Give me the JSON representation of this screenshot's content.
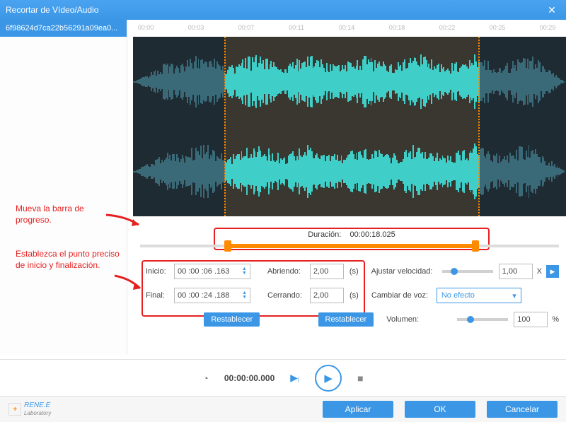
{
  "title": "Recortar de Vídeo/Audio",
  "sidebar": {
    "file_name": "6f98624d7ca22b56291a09ea0..."
  },
  "ruler": [
    "00:00",
    "00:03",
    "00:07",
    "00:11",
    "00:14",
    "00:18",
    "00:22",
    "00:25",
    "00:29"
  ],
  "selection": {
    "start_pct": 21,
    "end_pct": 80
  },
  "duration": {
    "label": "Duración:",
    "value": "00:00:18.025"
  },
  "annotations": {
    "a1": "Mueva la barra de progreso.",
    "a2": "Establezca el punto preciso de inicio y finalización."
  },
  "inputs": {
    "inicio_label": "Inicio:",
    "inicio_value": "00 :00 :06 .163",
    "final_label": "Final:",
    "final_value": "00 :00 :24 .188",
    "abriendo_label": "Abriendo:",
    "abriendo_value": "2,00",
    "cerrando_label": "Cerrando:",
    "cerrando_value": "2,00",
    "secs_unit": "(s)",
    "reset": "Restablecer",
    "speed_label": "Ajustar velocidad:",
    "speed_value": "1,00",
    "speed_unit": "X",
    "voice_label": "Cambiar de voz:",
    "voice_value": "No efecto",
    "volume_label": "Volumen:",
    "volume_value": "100",
    "volume_unit": "%"
  },
  "transport": {
    "time": "00:00:00.000"
  },
  "footer": {
    "brand": "RENE.E",
    "brand_sub": "Laboratory",
    "apply": "Aplicar",
    "ok": "OK",
    "cancel": "Cancelar"
  }
}
